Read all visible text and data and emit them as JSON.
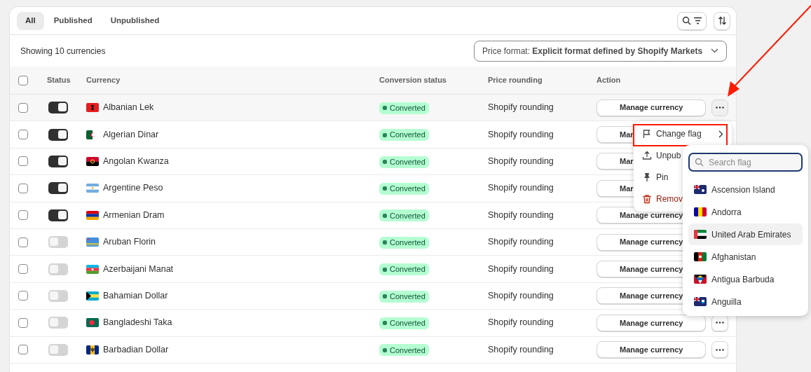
{
  "tabs": [
    {
      "label": "All",
      "selected": true
    },
    {
      "label": "Published",
      "selected": false
    },
    {
      "label": "Unpublished",
      "selected": false
    }
  ],
  "summary": "Showing 10 currencies",
  "price_format": "Price format: **Explicit format defined by Shopify Markets**",
  "table": {
    "select_all": {
      "checked": false
    },
    "columns": [
      "Status",
      "Currency",
      "Conversion status",
      "Price rounding",
      "Action"
    ],
    "rows": [
      {
        "checked": false,
        "on": true,
        "currency": "Albanian Lek",
        "conversion": "Converted",
        "rounding": "Shopify rounding",
        "action": "Manage currency",
        "more": {
          "menu_open": true
        }
      },
      {
        "checked": false,
        "on": true,
        "currency": "Algerian Dinar",
        "conversion": "Converted",
        "rounding": "Shopify rounding",
        "action": "Mar"
      },
      {
        "checked": false,
        "on": true,
        "currency": "Angolan Kwanza",
        "conversion": "Converted",
        "rounding": "Shopify rounding",
        "action": "Mar"
      },
      {
        "checked": false,
        "on": true,
        "currency": "Argentine Peso",
        "conversion": "Converted",
        "rounding": "Shopify rounding",
        "action": "Mar"
      },
      {
        "checked": false,
        "on": true,
        "currency": "Armenian Dram",
        "conversion": "Converted",
        "rounding": "Shopify rounding",
        "action": "Manage currency"
      },
      {
        "checked": false,
        "on": false,
        "currency": "Aruban Florin",
        "conversion": "Converted",
        "rounding": "Shopify rounding",
        "action": "Manage currency"
      },
      {
        "checked": false,
        "on": false,
        "currency": "Azerbaijani Manat",
        "conversion": "Converted",
        "rounding": "Shopify rounding",
        "action": "Manage currency"
      },
      {
        "checked": false,
        "on": false,
        "currency": "Bahamian Dollar",
        "conversion": "Converted",
        "rounding": "Shopify rounding",
        "action": "Manage currency"
      },
      {
        "checked": false,
        "on": false,
        "currency": "Bangladeshi Taka",
        "conversion": "Converted",
        "rounding": "Shopify rounding",
        "action": "Manage currency",
        "more": {
          "menu_open": false
        }
      },
      {
        "checked": false,
        "on": false,
        "currency": "Barbadian Dollar",
        "conversion": "Converted",
        "rounding": "Shopify rounding",
        "action": "Manage currency",
        "more": {
          "menu_open": false
        }
      }
    ]
  },
  "menu": {
    "items": [
      {
        "label": "Change flag",
        "has_submenu": true,
        "destructive": false,
        "annotated": true
      },
      {
        "label": "Unpub",
        "destructive": false,
        "annotated": false
      },
      {
        "label": "Pin",
        "destructive": false,
        "annotated": false
      },
      {
        "label": "Remov",
        "destructive": true,
        "annotated": false
      }
    ]
  },
  "flag_menu": {
    "search": {
      "placeholder": "Search flag"
    },
    "items": [
      {
        "label": "Ascension Island",
        "selected": false
      },
      {
        "label": "Andorra",
        "selected": false
      },
      {
        "label": "United Arab Emirates",
        "selected": true
      },
      {
        "label": "Afghanistan",
        "selected": false
      },
      {
        "label": "Antigua Barbuda",
        "selected": false
      },
      {
        "label": "Anguilla",
        "selected": false
      }
    ]
  }
}
